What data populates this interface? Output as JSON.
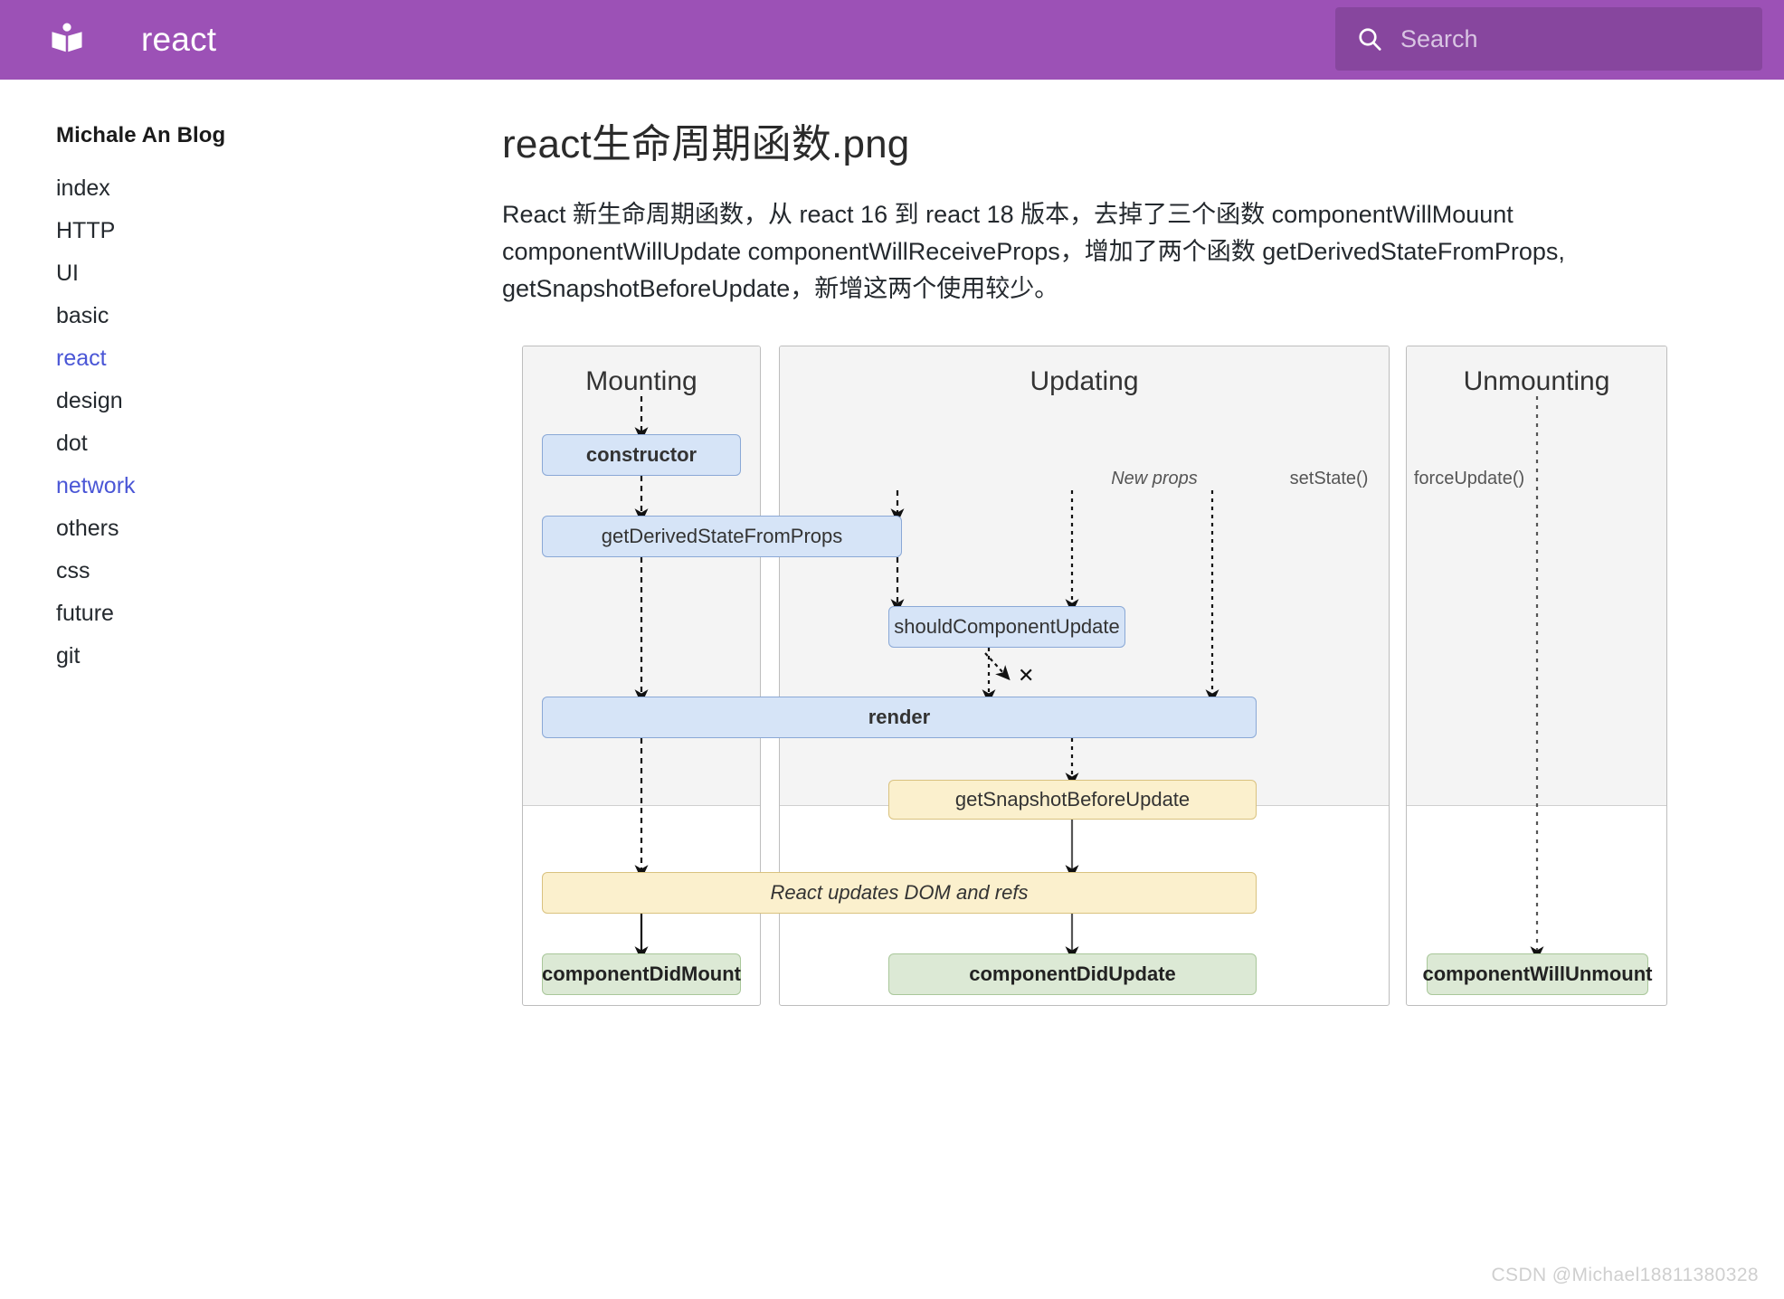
{
  "header": {
    "brand": "react",
    "logo_icon": "open-book-icon",
    "search": {
      "icon": "search-icon",
      "placeholder": "Search",
      "value": ""
    }
  },
  "sidebar": {
    "title": "Michale An Blog",
    "items": [
      {
        "label": "index",
        "active": false
      },
      {
        "label": "HTTP",
        "active": false
      },
      {
        "label": "UI",
        "active": false
      },
      {
        "label": "basic",
        "active": false
      },
      {
        "label": "react",
        "active": true
      },
      {
        "label": "design",
        "active": false
      },
      {
        "label": "dot",
        "active": false
      },
      {
        "label": "network",
        "active": true
      },
      {
        "label": "others",
        "active": false
      },
      {
        "label": "css",
        "active": false
      },
      {
        "label": "future",
        "active": false
      },
      {
        "label": "git",
        "active": false
      }
    ]
  },
  "main": {
    "page_title": "react生命周期函数.png",
    "intro": "React 新生命周期函数，从 react 16 到 react 18 版本，去掉了三个函数 componentWillMouunt componentWillUpdate componentWillReceiveProps，增加了两个函数 getDerivedStateFromProps, getSnapshotBeforeUpdate，新增这两个使用较少。"
  },
  "diagram": {
    "columns": [
      {
        "id": "mounting",
        "heading": "Mounting"
      },
      {
        "id": "updating",
        "heading": "Updating"
      },
      {
        "id": "unmounting",
        "heading": "Unmounting"
      }
    ],
    "triggers": [
      {
        "label": "New props",
        "italic": true
      },
      {
        "label": "setState()",
        "italic": false
      },
      {
        "label": "forceUpdate()",
        "italic": false
      }
    ],
    "nodes": {
      "constructor": "constructor",
      "getDerivedStateFromProps": "getDerivedStateFromProps",
      "shouldComponentUpdate": "shouldComponentUpdate",
      "render": "render",
      "getSnapshotBeforeUpdate": "getSnapshotBeforeUpdate",
      "reactUpdatesDom": "React updates DOM and refs",
      "componentDidMount": "componentDidMount",
      "componentDidUpdate": "componentDidUpdate",
      "componentWillUnmount": "componentWillUnmount"
    },
    "annotations": {
      "skip_render_mark": "✕"
    },
    "colors": {
      "blue_fill": "#d6e4f7",
      "blue_border": "#8aa8d6",
      "yellow_fill": "#fbf0cd",
      "yellow_border": "#d9c27f",
      "green_fill": "#dce9d5",
      "green_border": "#a9c79a",
      "panel_top_fill": "#f4f4f4",
      "panel_border": "#bdbdbd"
    }
  },
  "footer": {
    "credit": "CSDN @Michael18811380328"
  },
  "theme": {
    "header_purple": "#9c51b6",
    "link_blue": "#4a56d6"
  }
}
